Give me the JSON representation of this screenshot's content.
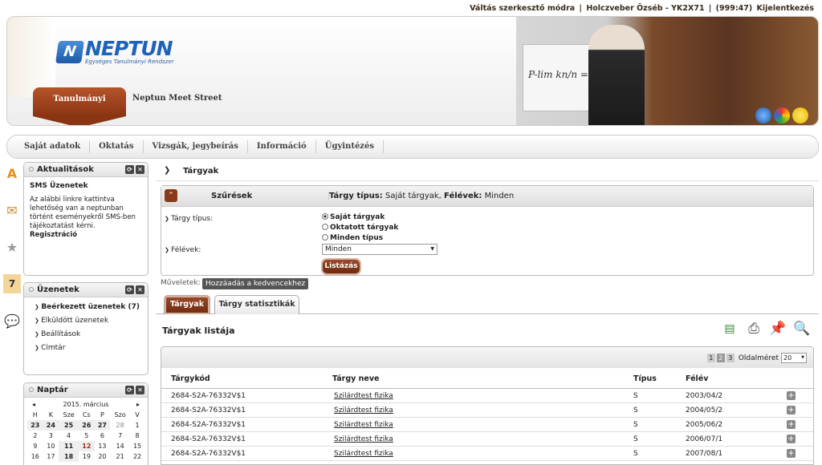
{
  "topbar": {
    "switch_mode": "Váltás szerkesztő módra",
    "user": "Holczveber Özséb - YK2X71",
    "sep": "|",
    "timer": "(999:47)",
    "logout": "Kijelentkezés"
  },
  "brand": {
    "name": "NEPTUN",
    "subtitle": "Egységes Tanulmányi Rendszer",
    "formula": "P-lim kn/n = P(A)"
  },
  "main_tabs": [
    {
      "label": "Tanulmányi rendszer",
      "active": true
    },
    {
      "label": "Neptun Meet Street",
      "active": false
    }
  ],
  "menu": [
    "Saját adatok",
    "Oktatás",
    "Vizsgák, jegybeírás",
    "Információ",
    "Ügyintézés"
  ],
  "side_icons": [
    "A",
    "✉",
    "★",
    "7",
    "💬"
  ],
  "aktualitasok": {
    "title": "Aktualitások",
    "heading": "SMS Üzenetek",
    "text": "Az alábbi linkre kattintva lehetőség van a neptunban történt eseményekről SMS-ben tájékoztatást kérni.",
    "link": "Regisztráció"
  },
  "uzenetek": {
    "title": "Üzenetek",
    "items": [
      "Beérkezett üzenetek (7)",
      "Elküldött üzenetek",
      "Beállítások",
      "Címtár"
    ]
  },
  "naptar": {
    "title": "Naptár",
    "month": "2015. március",
    "days": [
      "H",
      "K",
      "Sze",
      "Cs",
      "P",
      "Szo",
      "V"
    ],
    "weeks": [
      [
        "23",
        "24",
        "25",
        "26",
        "27",
        "28",
        "1"
      ],
      [
        "2",
        "3",
        "4",
        "5",
        "6",
        "7",
        "8"
      ],
      [
        "9",
        "10",
        "11",
        "12",
        "13",
        "14",
        "15"
      ],
      [
        "16",
        "17",
        "18",
        "19",
        "20",
        "21",
        "22"
      ]
    ]
  },
  "page": {
    "title": "Tárgyak"
  },
  "filter": {
    "title": "Szűrések",
    "summary_label1": "Tárgy típus:",
    "summary_val1": "Saját tárgyak",
    "summary_label2": "Félévek:",
    "summary_val2": "Minden",
    "type_label": "Tárgy típus:",
    "options": [
      "Saját tárgyak",
      "Oktatott tárgyak",
      "Minden típus"
    ],
    "selected_option": 0,
    "semester_label": "Félévek:",
    "semester_value": "Minden",
    "list_button": "Listázás"
  },
  "operations": {
    "label": "Műveletek:",
    "fav_button": "Hozzáadás a kedvencekhez"
  },
  "tabs": [
    "Tárgyak",
    "Tárgy statisztikák"
  ],
  "list": {
    "title": "Tárgyak listája",
    "toolbar_icons": [
      "xls-export-icon",
      "print-icon",
      "pin-icon",
      "search-icon"
    ],
    "pages": [
      "1",
      "2",
      "3"
    ],
    "current_page": "2",
    "page_size_label": "Oldalméret",
    "page_size": "20",
    "columns": [
      "Tárgykód",
      "Tárgy neve",
      "Típus",
      "Félév"
    ],
    "rows": [
      {
        "code": "2684-S2A-76332V$1",
        "name": "Szilárdtest fizika",
        "type": "S",
        "sem": "2003/04/2"
      },
      {
        "code": "2684-S2A-76332V$1",
        "name": "Szilárdtest fizika",
        "type": "S",
        "sem": "2004/05/2"
      },
      {
        "code": "2684-S2A-76332V$1",
        "name": "Szilárdtest fizika",
        "type": "S",
        "sem": "2005/06/2"
      },
      {
        "code": "2684-S2A-76332V$1",
        "name": "Szilárdtest fizika",
        "type": "S",
        "sem": "2006/07/1"
      },
      {
        "code": "2684-S2A-76332V$1",
        "name": "Szilárdtest fizika",
        "type": "S",
        "sem": "2007/08/1"
      }
    ]
  },
  "colors": {
    "accent": "#8a3412",
    "logo_blue": "#1f63b8"
  }
}
